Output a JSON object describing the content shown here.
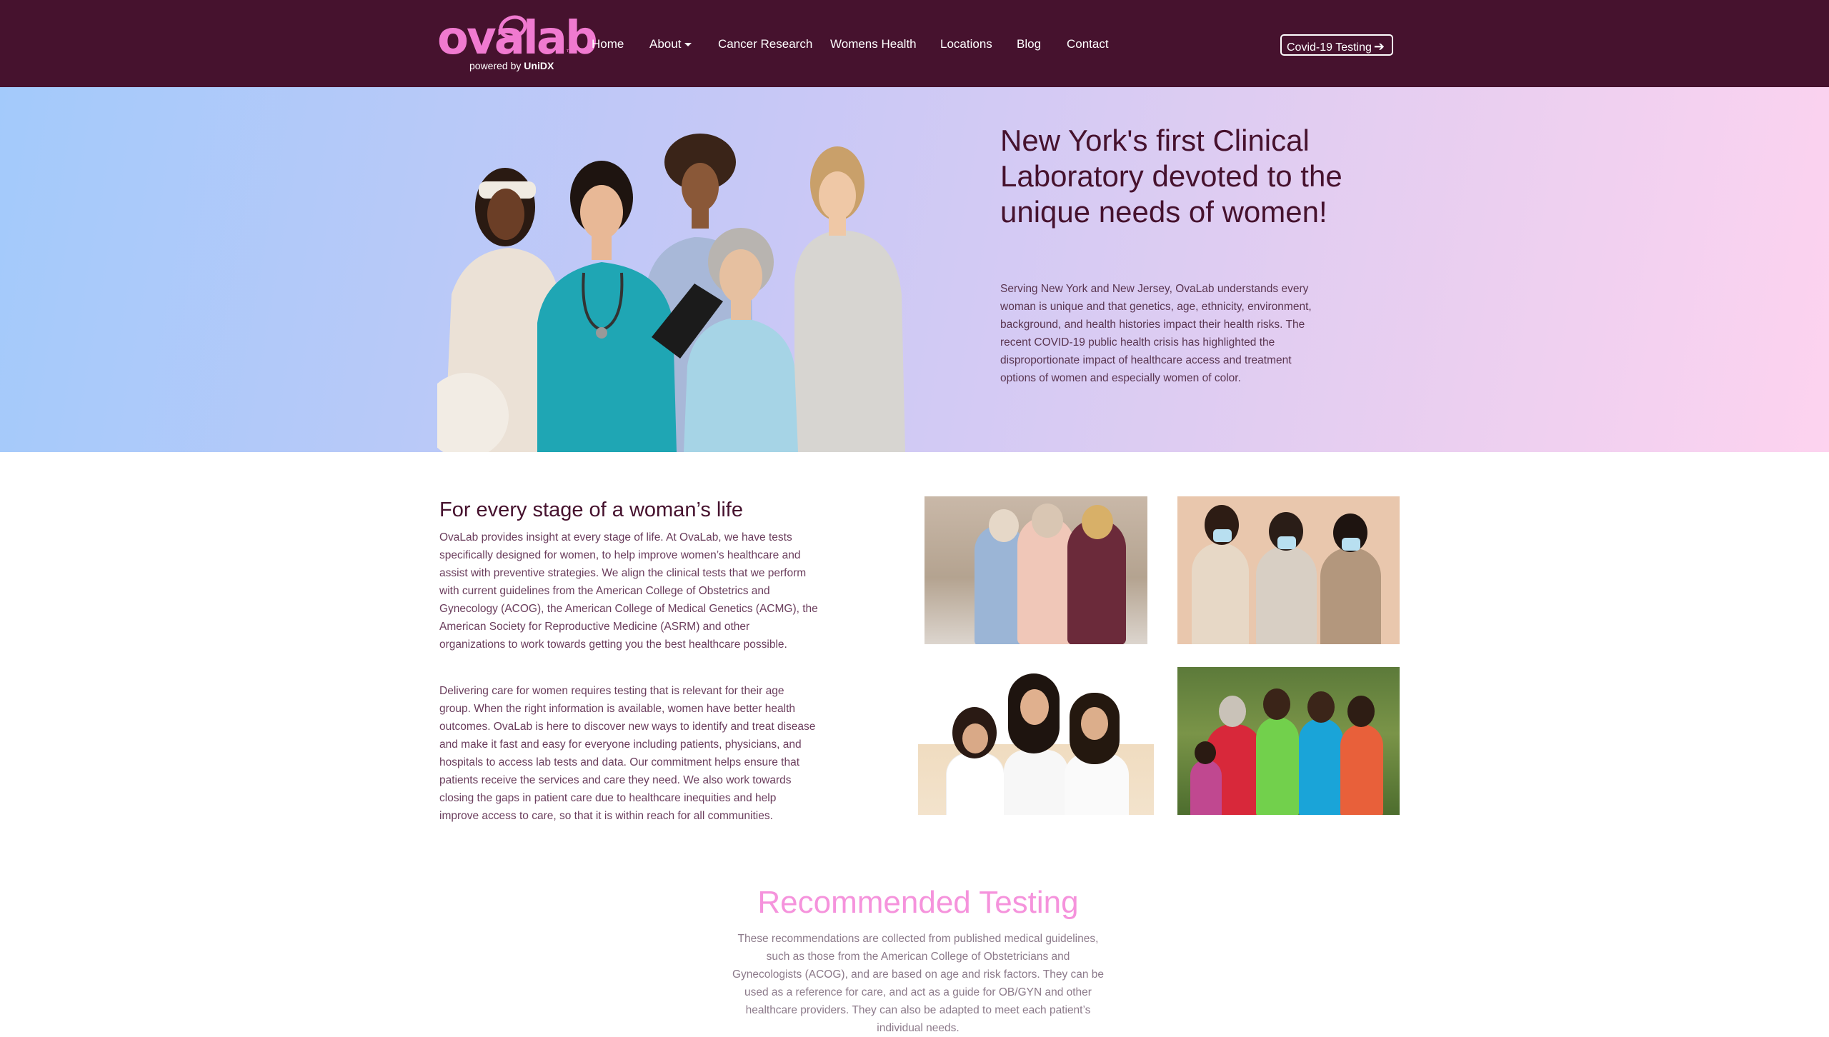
{
  "brand": {
    "logo_text": "ovalab",
    "tagline_prefix": "powered by",
    "tagline_brand": "UniDX",
    "trademark": "™"
  },
  "nav": {
    "items": [
      {
        "label": "Home"
      },
      {
        "label": "About"
      },
      {
        "label": "Cancer Research"
      },
      {
        "label": "Womens Health"
      },
      {
        "label": "Locations"
      },
      {
        "label": "Blog"
      },
      {
        "label": "Contact"
      }
    ],
    "cta_label": "Covid-19 Testing",
    "cta_arrow": "➔"
  },
  "hero": {
    "title": "New York's first Clinical Laboratory devoted to the unique needs of women!",
    "text": "Serving New York and New Jersey, OvaLab understands every woman is unique and that genetics, age, ethnicity, environment, background, and health histories impact their health risks. The recent COVID-19 public health crisis has highlighted the disproportionate impact of healthcare access and treatment options of women and especially women of color."
  },
  "intro": {
    "title": "For every stage of a woman’s life",
    "paragraphs": [
      "OvaLab provides insight at every stage of life. At OvaLab, we have tests specifically designed for women, to help improve women’s healthcare and assist with preventive strategies. We align the clinical tests that we perform with current guidelines from the American College of Obstetrics and Gynecology (ACOG), the American College of Medical Genetics (ACMG), the American Society for Reproductive Medicine (ASRM) and other organizations to work towards getting you the best healthcare possible.",
      "Delivering care for women requires testing that is relevant for their age group. When the right information is available, women have better health outcomes. OvaLab is here to discover new ways to identify and treat disease and make it fast and easy for everyone including patients, physicians, and hospitals to access lab tests and data. Our commitment helps ensure that patients receive the services and care they need. We also work towards closing the gaps in patient care due to healthcare inequities and help improve access to care, so that it is within reach for all communities."
    ]
  },
  "recommended": {
    "title": "Recommended Testing",
    "text": "These recommendations are collected from published medical guidelines, such as those from the American College of Obstetricians and Gynecologists (ACOG), and are based on age and risk factors. They can be used as a reference for care, and act as a guide for OB/GYN and other healthcare providers. They can also be adapted to meet each patient’s individual needs."
  },
  "colors": {
    "nav_bg": "#46122e",
    "brand_pink": "#f07ad0",
    "heading_plum": "#46122e",
    "accent_pink": "#f593dc"
  }
}
